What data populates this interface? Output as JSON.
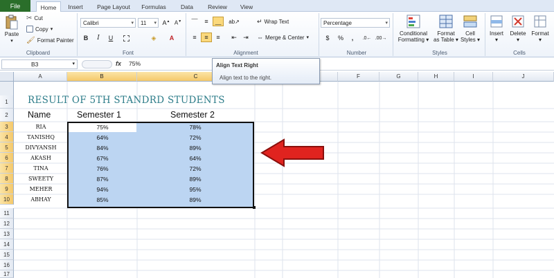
{
  "tabs": [
    {
      "label": "File"
    },
    {
      "label": "Home"
    },
    {
      "label": "Insert"
    },
    {
      "label": "Page Layout"
    },
    {
      "label": "Formulas"
    },
    {
      "label": "Data"
    },
    {
      "label": "Review"
    },
    {
      "label": "View"
    }
  ],
  "clipboard": {
    "paste": "Paste",
    "cut": "Cut",
    "copy": "Copy",
    "format_painter": "Format Painter",
    "label": "Clipboard"
  },
  "font": {
    "name": "Calibri",
    "size": "11",
    "label": "Font"
  },
  "alignment": {
    "wrap_text": "Wrap Text",
    "merge_center": "Merge & Center",
    "label": "Alignment"
  },
  "number": {
    "format": "Percentage",
    "currency": "$",
    "percent": "%",
    "comma": ",",
    "label": "Number"
  },
  "styles": {
    "conditional_formatting_1": "Conditional",
    "conditional_formatting_2": "Formatting",
    "format_table_1": "Format",
    "format_table_2": "as Table",
    "cell_styles_1": "Cell",
    "cell_styles_2": "Styles",
    "label": "Styles"
  },
  "cells": {
    "insert": "Insert",
    "delete": "Delete",
    "format": "Format",
    "label": "Cells"
  },
  "tooltip": {
    "title": "Align Text Right",
    "description": "Align text to the right."
  },
  "formula_bar": {
    "name_box": "B3",
    "fx": "fx",
    "value": "75%"
  },
  "columns": [
    "A",
    "B",
    "C",
    "D",
    "E",
    "F",
    "G",
    "H",
    "I",
    "J"
  ],
  "rows": [
    "1",
    "2",
    "3",
    "4",
    "5",
    "6",
    "7",
    "8",
    "9",
    "10",
    "11",
    "12",
    "13",
    "14",
    "15",
    "16",
    "17"
  ],
  "sheet": {
    "title": "RESULT OF 5TH STANDRD STUDENTS",
    "header_name": "Name",
    "header_sem1": "Semester 1",
    "header_sem2": "Semester 2",
    "students": [
      {
        "name": "RIA",
        "sem1": "75%",
        "sem2": "78%"
      },
      {
        "name": "TANISHQ",
        "sem1": "64%",
        "sem2": "72%"
      },
      {
        "name": "DIVYANSH",
        "sem1": "84%",
        "sem2": "89%"
      },
      {
        "name": "AKASH",
        "sem1": "67%",
        "sem2": "64%"
      },
      {
        "name": "TINA",
        "sem1": "76%",
        "sem2": "72%"
      },
      {
        "name": "SWEETY",
        "sem1": "87%",
        "sem2": "89%"
      },
      {
        "name": "MEHER",
        "sem1": "94%",
        "sem2": "95%"
      },
      {
        "name": "ABHAY",
        "sem1": "85%",
        "sem2": "89%"
      }
    ]
  },
  "colors": {
    "selection": "#bcd5f2",
    "title": "#2e7d8a",
    "arrow": "#e0231f",
    "file_tab": "#2a6e2a"
  }
}
